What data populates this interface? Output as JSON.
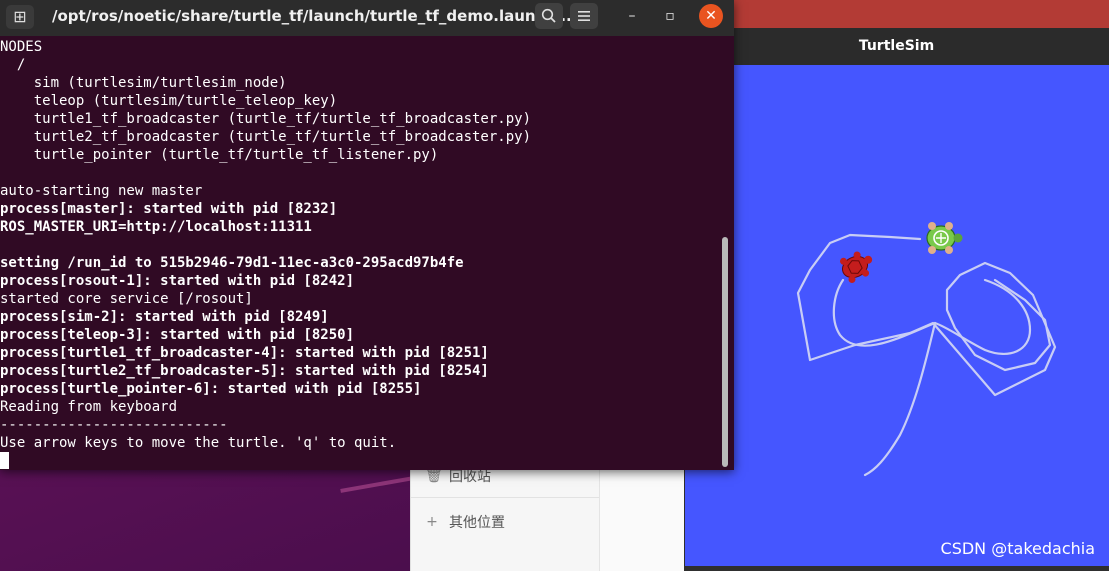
{
  "terminal": {
    "title": "/opt/ros/noetic/share/turtle_tf/launch/turtle_tf_demo.launch ...",
    "new_tab_icon": "new-tab-icon",
    "search_icon": "search-icon",
    "menu_icon": "hamburger-menu-icon",
    "lines": [
      {
        "text": "NODES",
        "bold": false
      },
      {
        "text": "  /",
        "bold": false
      },
      {
        "text": "    sim (turtlesim/turtlesim_node)",
        "bold": false
      },
      {
        "text": "    teleop (turtlesim/turtle_teleop_key)",
        "bold": false
      },
      {
        "text": "    turtle1_tf_broadcaster (turtle_tf/turtle_tf_broadcaster.py)",
        "bold": false
      },
      {
        "text": "    turtle2_tf_broadcaster (turtle_tf/turtle_tf_broadcaster.py)",
        "bold": false
      },
      {
        "text": "    turtle_pointer (turtle_tf/turtle_tf_listener.py)",
        "bold": false
      },
      {
        "text": "",
        "bold": false
      },
      {
        "text": "auto-starting new master",
        "bold": false
      },
      {
        "text": "process[master]: started with pid [8232]",
        "bold": true
      },
      {
        "text": "ROS_MASTER_URI=http://localhost:11311",
        "bold": true
      },
      {
        "text": "",
        "bold": false
      },
      {
        "text": "setting /run_id to 515b2946-79d1-11ec-a3c0-295acd97b4fe",
        "bold": true
      },
      {
        "text": "process[rosout-1]: started with pid [8242]",
        "bold": true
      },
      {
        "text": "started core service [/rosout]",
        "bold": false
      },
      {
        "text": "process[sim-2]: started with pid [8249]",
        "bold": true
      },
      {
        "text": "process[teleop-3]: started with pid [8250]",
        "bold": true
      },
      {
        "text": "process[turtle1_tf_broadcaster-4]: started with pid [8251]",
        "bold": true
      },
      {
        "text": "process[turtle2_tf_broadcaster-5]: started with pid [8254]",
        "bold": true
      },
      {
        "text": "process[turtle_pointer-6]: started with pid [8255]",
        "bold": true
      },
      {
        "text": "Reading from keyboard",
        "bold": false
      },
      {
        "text": "---------------------------",
        "bold": false
      },
      {
        "text": "Use arrow keys to move the turtle. 'q' to quit.",
        "bold": false
      }
    ]
  },
  "turtlesim": {
    "title": "TurtleSim",
    "background_color": "#4556ff",
    "trail_color": "#c8cdf5"
  },
  "files": {
    "items": [
      {
        "label": "回收站",
        "icon": "trash-icon"
      },
      {
        "label": "其他位置",
        "icon": "plus-icon"
      }
    ]
  },
  "watermark": "CSDN @takedachia"
}
